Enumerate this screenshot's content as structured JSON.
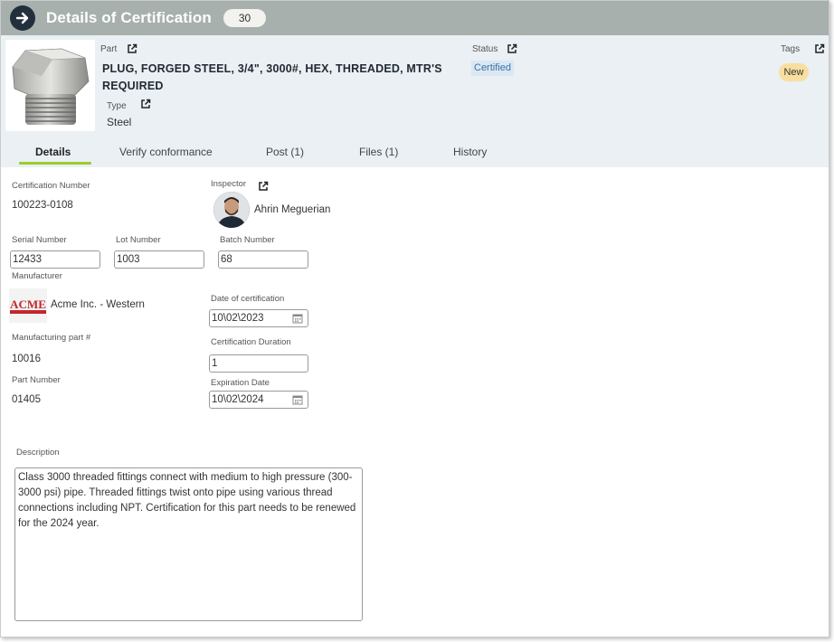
{
  "topbar": {
    "title": "Details of Certification",
    "count": "30"
  },
  "header": {
    "part_label": "Part",
    "part_name": "PLUG, FORGED STEEL, 3/4\", 3000#, HEX, THREADED, MTR'S REQUIRED",
    "type_label": "Type",
    "type_value": "Steel",
    "status_label": "Status",
    "status_value": "Certified",
    "tags_label": "Tags",
    "tag_value": "New"
  },
  "tabs": [
    {
      "label": "Details"
    },
    {
      "label": "Verify conformance"
    },
    {
      "label": "Post (1)"
    },
    {
      "label": "Files (1)"
    },
    {
      "label": "History"
    }
  ],
  "fields": {
    "certification_number": {
      "label": "Certification Number",
      "value": "100223-0108"
    },
    "inspector": {
      "label": "Inspector",
      "value": "Ahrin Meguerian"
    },
    "serial_number": {
      "label": "Serial Number",
      "value": "12433"
    },
    "lot_number": {
      "label": "Lot Number",
      "value": "1003"
    },
    "batch_number": {
      "label": "Batch Number",
      "value": "68"
    },
    "manufacturer": {
      "label": "Manufacturer",
      "value": "Acme Inc. - Western",
      "logo_text": "ACME"
    },
    "date_of_certification": {
      "label": "Date of certification",
      "value": "10\\02\\2023"
    },
    "manufacturing_part": {
      "label": "Manufacturing part #",
      "value": "10016"
    },
    "certification_duration": {
      "label": "Certification Duration",
      "value": "1"
    },
    "part_number": {
      "label": "Part Number",
      "value": "01405"
    },
    "expiration_date": {
      "label": "Expiration Date",
      "value": "10\\02\\2024"
    },
    "description": {
      "label": "Description",
      "value": "Class 3000 threaded fittings connect with medium to high pressure (300-3000 psi) pipe. Threaded fittings twist onto pipe using various thread connections including NPT. Certification for this part needs to be renewed for the 2024 year."
    }
  },
  "colors": {
    "topbar": "#a7b0ac",
    "header_bg": "#eaf0f4",
    "active_tab": "#9ccc2e",
    "status_text": "#3a6fa8",
    "tag_bg": "#f7df9f"
  }
}
